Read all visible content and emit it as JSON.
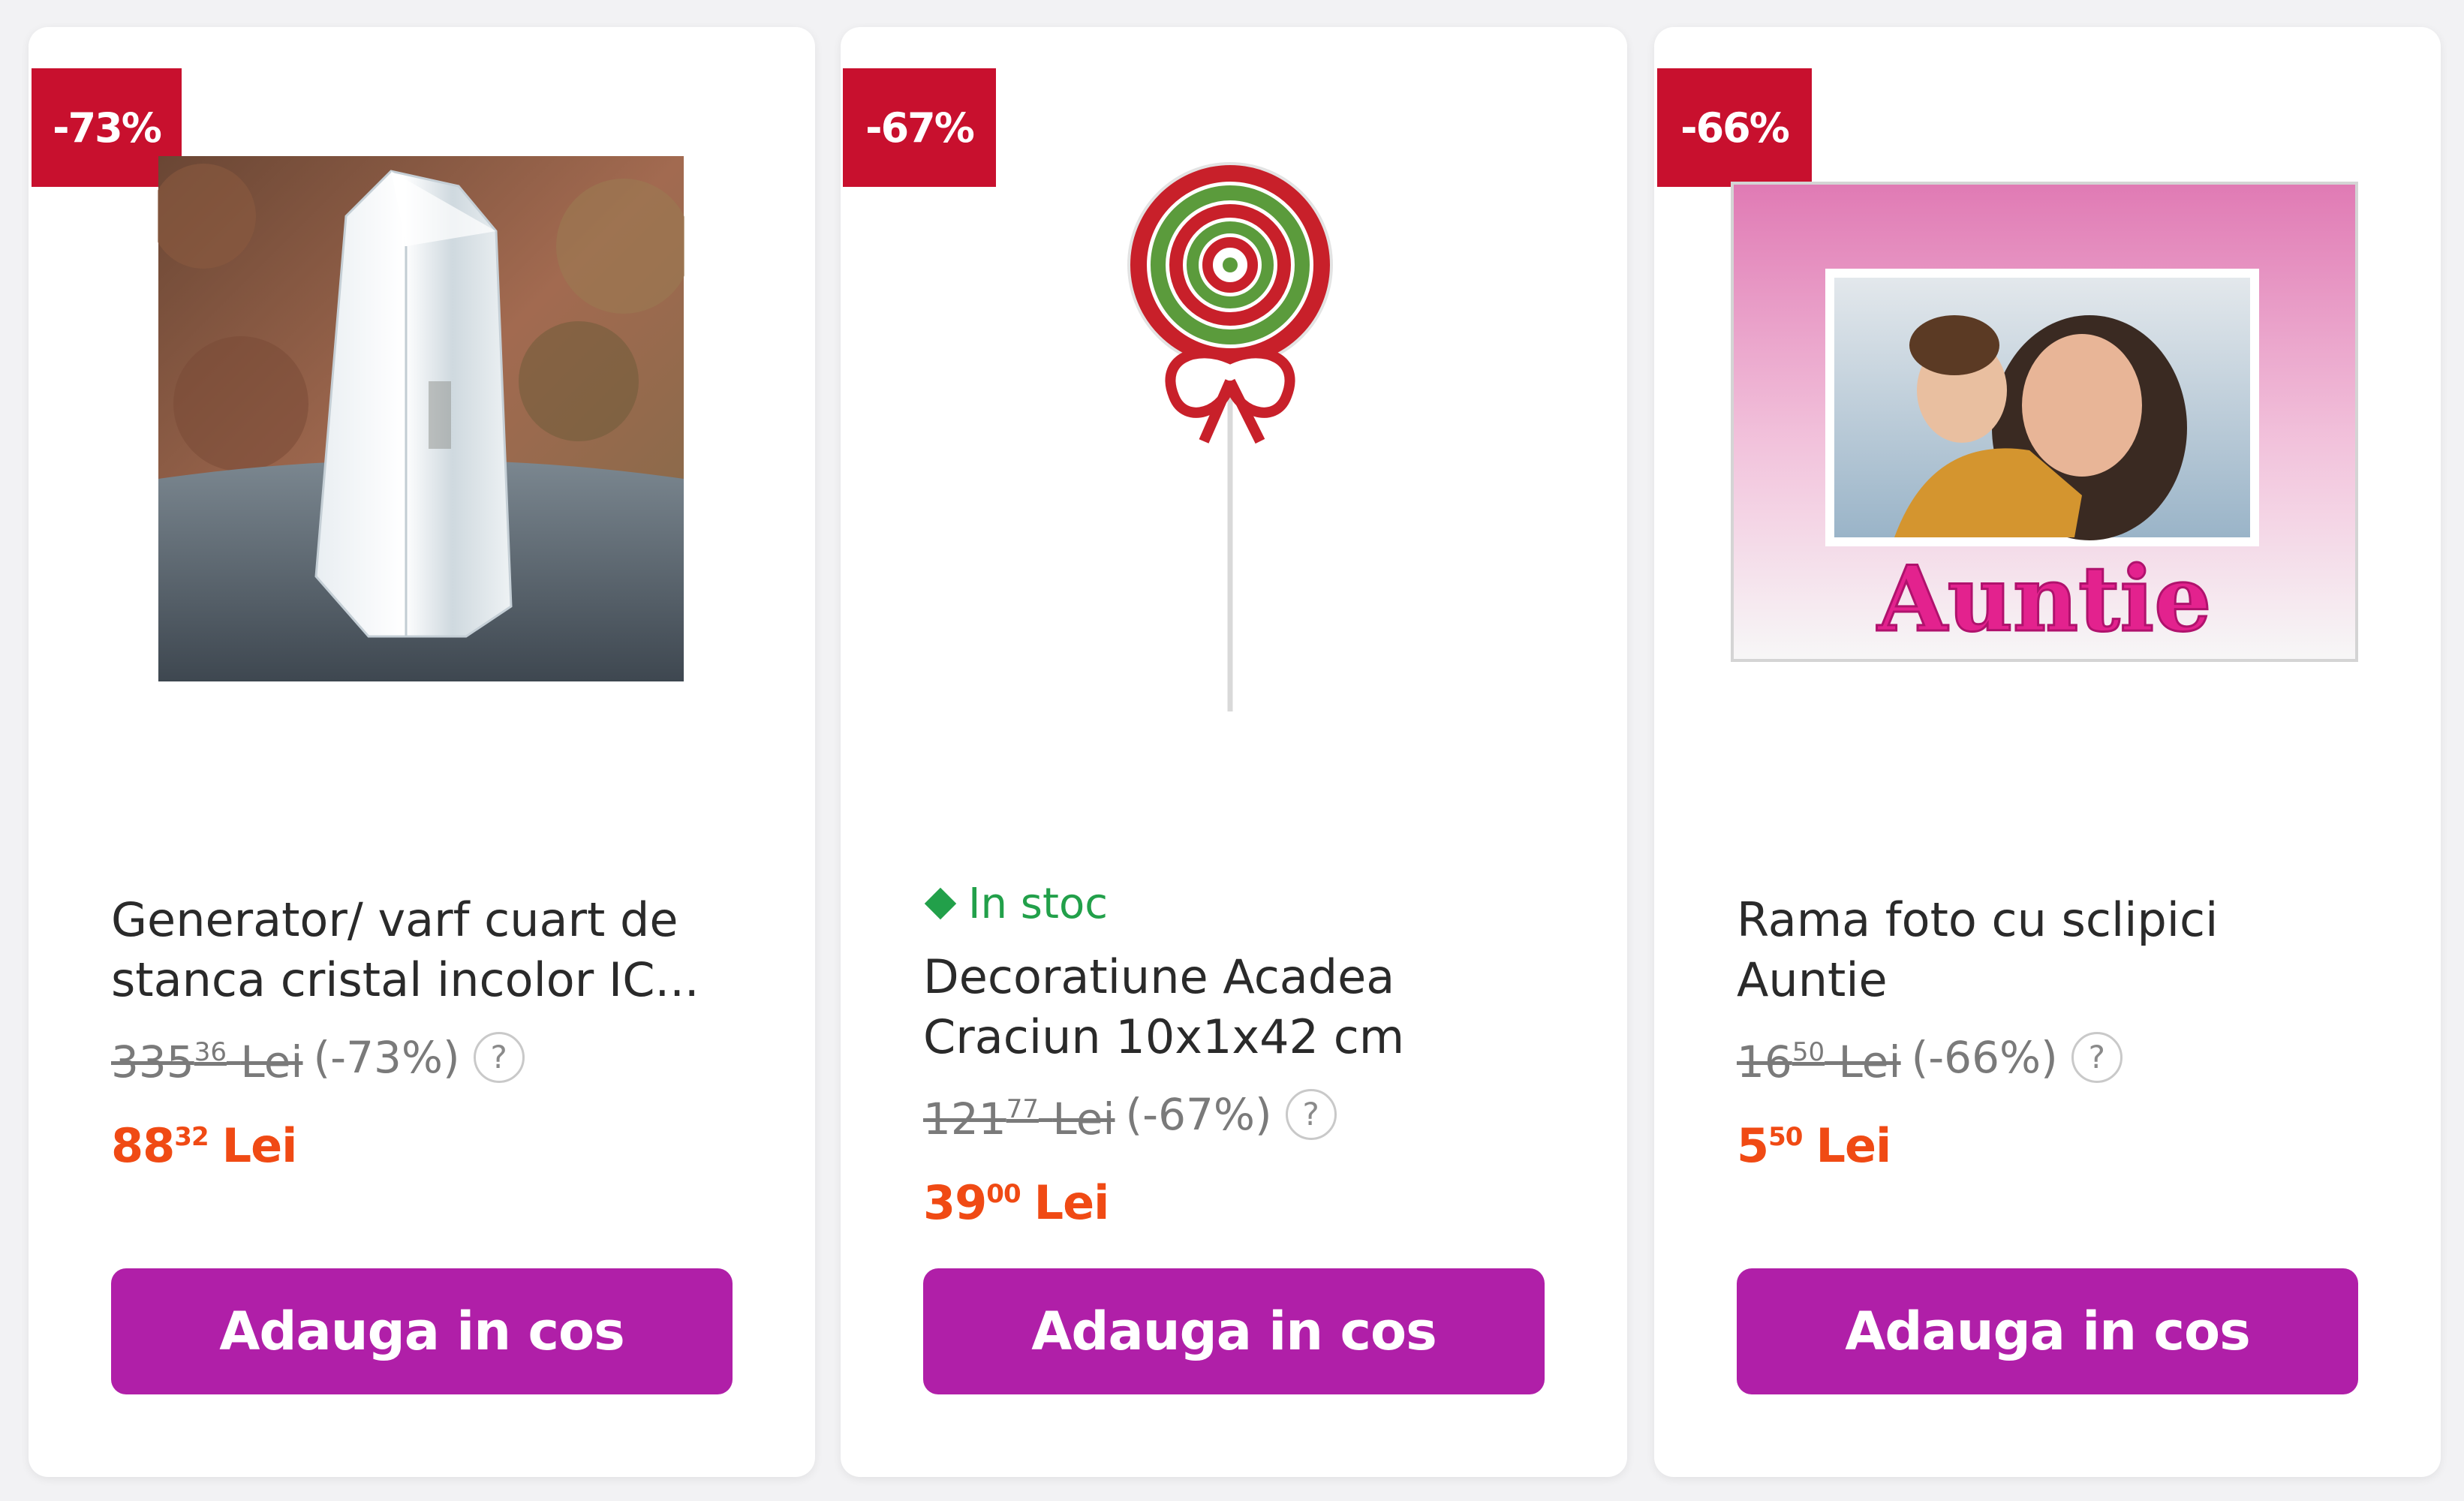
{
  "products": [
    {
      "discount_badge": "-73%",
      "image_icon": "quartz-crystal-point-photo",
      "in_stock": "",
      "title": "Generator/ varf cuart de stanca cristal incolor IC...",
      "old_price_int": "335",
      "old_price_dec": "36",
      "old_currency": "Lei",
      "discount_text": "(-73%)",
      "help": "?",
      "price_int": "88",
      "price_dec": "32",
      "currency": "Lei",
      "button_label": "Adauga in cos"
    },
    {
      "discount_badge": "-67%",
      "image_icon": "lollipop-decoration-photo",
      "in_stock": "In stoc",
      "title": "Decoratiune Acadea Craciun 10x1x42 cm",
      "old_price_int": "121",
      "old_price_dec": "77",
      "old_currency": "Lei",
      "discount_text": "(-67%)",
      "help": "?",
      "price_int": "39",
      "price_dec": "00",
      "currency": "Lei",
      "button_label": "Adauga in cos"
    },
    {
      "discount_badge": "-66%",
      "image_icon": "glitter-photo-frame-photo",
      "frame_caption": "Auntie",
      "in_stock": "",
      "title": "Rama foto cu sclipici Auntie",
      "old_price_int": "16",
      "old_price_dec": "50",
      "old_currency": "Lei",
      "discount_text": "(-66%)",
      "help": "?",
      "price_int": "5",
      "price_dec": "50",
      "currency": "Lei",
      "button_label": "Adauga in cos"
    }
  ],
  "colors": {
    "badge": "#c8102e",
    "stock": "#22a04a",
    "price": "#f04a14",
    "button": "#b01fa8"
  }
}
